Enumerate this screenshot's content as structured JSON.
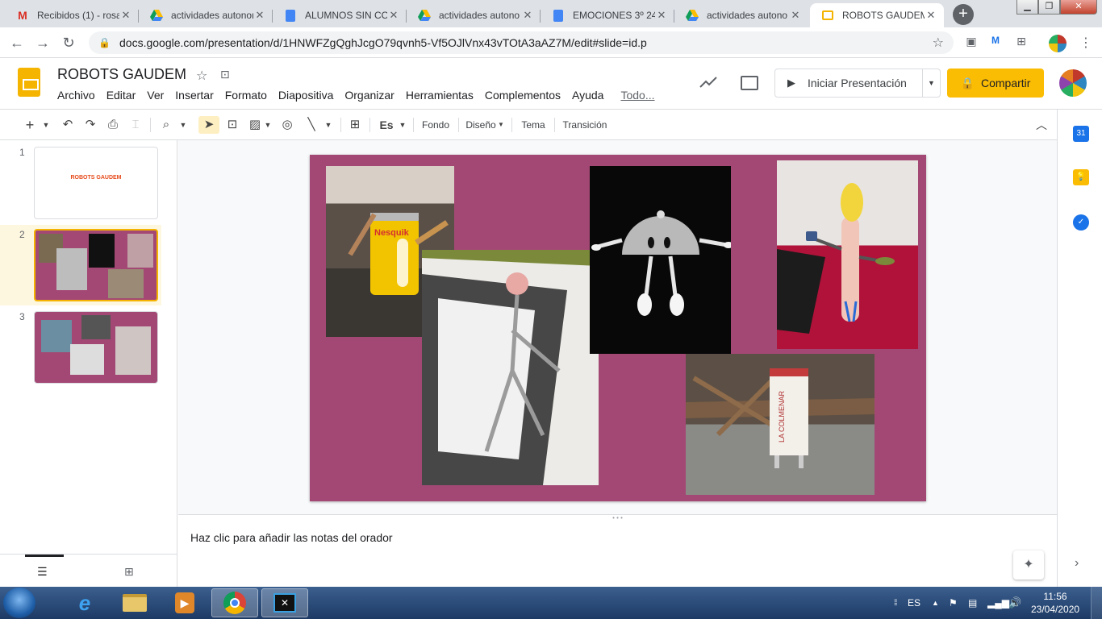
{
  "browser": {
    "tabs": [
      {
        "title": "Recibidos (1) - rosa",
        "icon": "gmail-icon",
        "active": false
      },
      {
        "title": "actividades autonor",
        "icon": "drive-icon",
        "active": false
      },
      {
        "title": "ALUMNOS SIN CO",
        "icon": "docs-icon",
        "active": false
      },
      {
        "title": "actividades autono",
        "icon": "drive-icon",
        "active": false
      },
      {
        "title": "EMOCIONES 3º 24",
        "icon": "docs-icon",
        "active": false
      },
      {
        "title": "actividades autono",
        "icon": "drive-icon",
        "active": false
      },
      {
        "title": "ROBOTS GAUDEM",
        "icon": "slides-icon",
        "active": true
      }
    ],
    "url": "docs.google.com/presentation/d/1HNWFZgQghJcgO79qvnh5-Vf5OJlVnx43vTOtA3aAZ7M/edit#slide=id.p"
  },
  "app": {
    "title": "ROBOTS GAUDEM",
    "menu": [
      "Archivo",
      "Editar",
      "Ver",
      "Insertar",
      "Formato",
      "Diapositiva",
      "Organizar",
      "Herramientas",
      "Complementos",
      "Ayuda"
    ],
    "last_edit": "Todo...",
    "present_label": "Iniciar Presentación",
    "share_label": "Compartir"
  },
  "edit_toolbar": {
    "background": "Fondo",
    "layout": "Diseño",
    "theme": "Tema",
    "transition": "Transición"
  },
  "filmstrip": {
    "slides": [
      {
        "number": "1",
        "title": "ROBOTS GAUDEM"
      },
      {
        "number": "2",
        "title": ""
      },
      {
        "number": "3",
        "title": ""
      }
    ],
    "selected": "2"
  },
  "slide": {
    "background_color": "#a34874",
    "photos": [
      "nesquik-robot-photo",
      "spoon-lid-robot-photo",
      "lemon-robot-photo",
      "fork-robot-photo",
      "milk-carton-robot-photo"
    ]
  },
  "notes": {
    "placeholder": "Haz clic para añadir las notas del orador"
  },
  "taskbar": {
    "language": "ES",
    "time": "11:56",
    "date": "23/04/2020"
  }
}
